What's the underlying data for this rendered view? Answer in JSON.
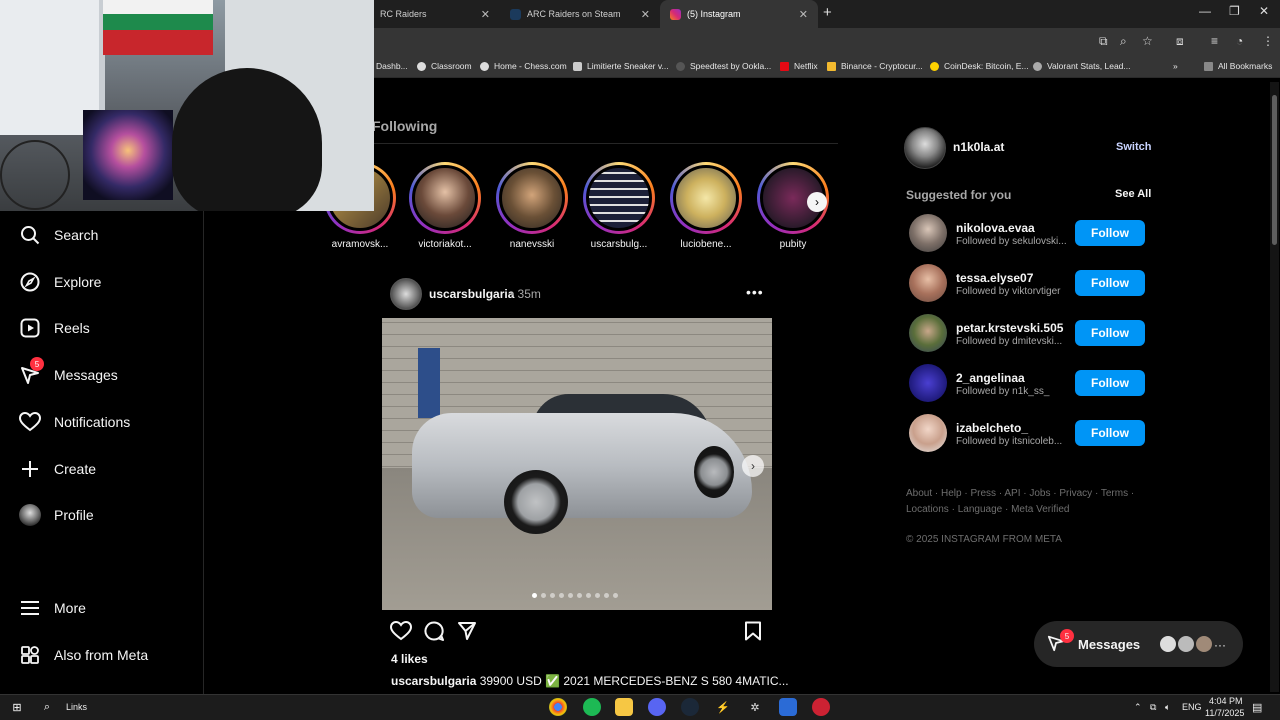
{
  "browser": {
    "tabs": [
      {
        "label": "RC Raiders"
      },
      {
        "label": "ARC Raiders on Steam"
      },
      {
        "label": "(5) Instagram"
      }
    ],
    "bookmarks": [
      "Dashb...",
      "Classroom",
      "Home - Chess.com",
      "Limitierte Sneaker v...",
      "Speedtest by Ookla...",
      "Netflix",
      "Binance - Cryptocur...",
      "CoinDesk: Bitcoin, E...",
      "Valorant Stats, Lead...",
      "All Bookmarks"
    ]
  },
  "nav": {
    "items": [
      {
        "label": "Search"
      },
      {
        "label": "Explore"
      },
      {
        "label": "Reels"
      },
      {
        "label": "Messages",
        "badge": "5"
      },
      {
        "label": "Notifications"
      },
      {
        "label": "Create"
      },
      {
        "label": "Profile"
      },
      {
        "label": "More"
      },
      {
        "label": "Also from Meta"
      }
    ]
  },
  "feed": {
    "following_title": "Following",
    "stories": [
      {
        "name": "avramovsk..."
      },
      {
        "name": "victoriakot..."
      },
      {
        "name": "nanevsski"
      },
      {
        "name": "uscarsbulg..."
      },
      {
        "name": "luciobene..."
      },
      {
        "name": "pubity"
      }
    ],
    "post": {
      "username": "uscarsbulgaria",
      "time": "• 35m",
      "likes": "4 likes",
      "caption_user": "uscarsbulgaria",
      "caption_text": " 39900 USD ✅ 2021 MERCEDES-BENZ S 580 4MATIC..."
    }
  },
  "sidebar": {
    "me_name": "n1k0la.at",
    "switch": "Switch",
    "suggested_title": "Suggested for you",
    "see_all": "See All",
    "follow_label": "Follow",
    "suggestions": [
      {
        "name": "nikolova.evaa",
        "sub": "Followed by sekulovski..."
      },
      {
        "name": "tessa.elyse07",
        "sub": "Followed by viktorvtiger"
      },
      {
        "name": "petar.krstevski.505",
        "sub": "Followed by dmitevski..."
      },
      {
        "name": "2_angelinaa",
        "sub": "Followed by n1k_ss_"
      },
      {
        "name": "izabelcheto_",
        "sub": "Followed by itsnicoleb..."
      }
    ],
    "footer_line1": "About · Help · Press · API · Jobs · Privacy · Terms ·",
    "footer_line2": "Locations · Language · Meta Verified",
    "copyright": "© 2025 INSTAGRAM FROM META"
  },
  "messages_pill": {
    "label": "Messages",
    "badge": "5"
  },
  "taskbar": {
    "search_label": "Links",
    "lang": "ENG",
    "time": "4:04 PM",
    "date": "11/7/2025"
  }
}
